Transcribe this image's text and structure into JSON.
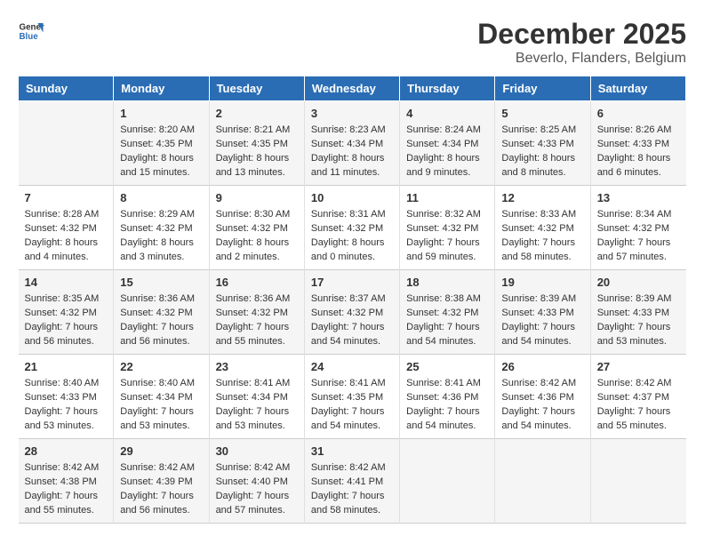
{
  "logo": {
    "line1": "General",
    "line2": "Blue"
  },
  "title": "December 2025",
  "subtitle": "Beverlo, Flanders, Belgium",
  "days_of_week": [
    "Sunday",
    "Monday",
    "Tuesday",
    "Wednesday",
    "Thursday",
    "Friday",
    "Saturday"
  ],
  "weeks": [
    [
      {
        "day": null,
        "content": ""
      },
      {
        "day": "1",
        "content": "Sunrise: 8:20 AM\nSunset: 4:35 PM\nDaylight: 8 hours\nand 15 minutes."
      },
      {
        "day": "2",
        "content": "Sunrise: 8:21 AM\nSunset: 4:35 PM\nDaylight: 8 hours\nand 13 minutes."
      },
      {
        "day": "3",
        "content": "Sunrise: 8:23 AM\nSunset: 4:34 PM\nDaylight: 8 hours\nand 11 minutes."
      },
      {
        "day": "4",
        "content": "Sunrise: 8:24 AM\nSunset: 4:34 PM\nDaylight: 8 hours\nand 9 minutes."
      },
      {
        "day": "5",
        "content": "Sunrise: 8:25 AM\nSunset: 4:33 PM\nDaylight: 8 hours\nand 8 minutes."
      },
      {
        "day": "6",
        "content": "Sunrise: 8:26 AM\nSunset: 4:33 PM\nDaylight: 8 hours\nand 6 minutes."
      }
    ],
    [
      {
        "day": "7",
        "content": "Sunrise: 8:28 AM\nSunset: 4:32 PM\nDaylight: 8 hours\nand 4 minutes."
      },
      {
        "day": "8",
        "content": "Sunrise: 8:29 AM\nSunset: 4:32 PM\nDaylight: 8 hours\nand 3 minutes."
      },
      {
        "day": "9",
        "content": "Sunrise: 8:30 AM\nSunset: 4:32 PM\nDaylight: 8 hours\nand 2 minutes."
      },
      {
        "day": "10",
        "content": "Sunrise: 8:31 AM\nSunset: 4:32 PM\nDaylight: 8 hours\nand 0 minutes."
      },
      {
        "day": "11",
        "content": "Sunrise: 8:32 AM\nSunset: 4:32 PM\nDaylight: 7 hours\nand 59 minutes."
      },
      {
        "day": "12",
        "content": "Sunrise: 8:33 AM\nSunset: 4:32 PM\nDaylight: 7 hours\nand 58 minutes."
      },
      {
        "day": "13",
        "content": "Sunrise: 8:34 AM\nSunset: 4:32 PM\nDaylight: 7 hours\nand 57 minutes."
      }
    ],
    [
      {
        "day": "14",
        "content": "Sunrise: 8:35 AM\nSunset: 4:32 PM\nDaylight: 7 hours\nand 56 minutes."
      },
      {
        "day": "15",
        "content": "Sunrise: 8:36 AM\nSunset: 4:32 PM\nDaylight: 7 hours\nand 56 minutes."
      },
      {
        "day": "16",
        "content": "Sunrise: 8:36 AM\nSunset: 4:32 PM\nDaylight: 7 hours\nand 55 minutes."
      },
      {
        "day": "17",
        "content": "Sunrise: 8:37 AM\nSunset: 4:32 PM\nDaylight: 7 hours\nand 54 minutes."
      },
      {
        "day": "18",
        "content": "Sunrise: 8:38 AM\nSunset: 4:32 PM\nDaylight: 7 hours\nand 54 minutes."
      },
      {
        "day": "19",
        "content": "Sunrise: 8:39 AM\nSunset: 4:33 PM\nDaylight: 7 hours\nand 54 minutes."
      },
      {
        "day": "20",
        "content": "Sunrise: 8:39 AM\nSunset: 4:33 PM\nDaylight: 7 hours\nand 53 minutes."
      }
    ],
    [
      {
        "day": "21",
        "content": "Sunrise: 8:40 AM\nSunset: 4:33 PM\nDaylight: 7 hours\nand 53 minutes."
      },
      {
        "day": "22",
        "content": "Sunrise: 8:40 AM\nSunset: 4:34 PM\nDaylight: 7 hours\nand 53 minutes."
      },
      {
        "day": "23",
        "content": "Sunrise: 8:41 AM\nSunset: 4:34 PM\nDaylight: 7 hours\nand 53 minutes."
      },
      {
        "day": "24",
        "content": "Sunrise: 8:41 AM\nSunset: 4:35 PM\nDaylight: 7 hours\nand 54 minutes."
      },
      {
        "day": "25",
        "content": "Sunrise: 8:41 AM\nSunset: 4:36 PM\nDaylight: 7 hours\nand 54 minutes."
      },
      {
        "day": "26",
        "content": "Sunrise: 8:42 AM\nSunset: 4:36 PM\nDaylight: 7 hours\nand 54 minutes."
      },
      {
        "day": "27",
        "content": "Sunrise: 8:42 AM\nSunset: 4:37 PM\nDaylight: 7 hours\nand 55 minutes."
      }
    ],
    [
      {
        "day": "28",
        "content": "Sunrise: 8:42 AM\nSunset: 4:38 PM\nDaylight: 7 hours\nand 55 minutes."
      },
      {
        "day": "29",
        "content": "Sunrise: 8:42 AM\nSunset: 4:39 PM\nDaylight: 7 hours\nand 56 minutes."
      },
      {
        "day": "30",
        "content": "Sunrise: 8:42 AM\nSunset: 4:40 PM\nDaylight: 7 hours\nand 57 minutes."
      },
      {
        "day": "31",
        "content": "Sunrise: 8:42 AM\nSunset: 4:41 PM\nDaylight: 7 hours\nand 58 minutes."
      },
      {
        "day": null,
        "content": ""
      },
      {
        "day": null,
        "content": ""
      },
      {
        "day": null,
        "content": ""
      }
    ]
  ]
}
